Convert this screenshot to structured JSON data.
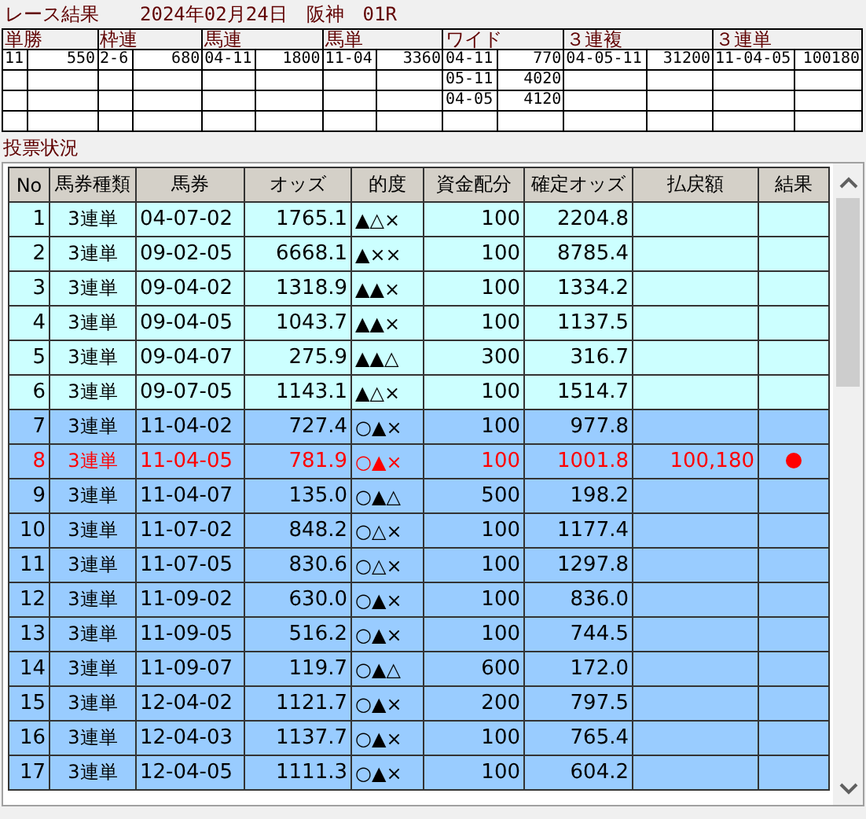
{
  "title": "レース結果",
  "date": "2024年02月24日",
  "venue": "阪神",
  "race": "01R",
  "results": [
    {
      "label": "単勝",
      "entries": [
        [
          "11",
          "550"
        ]
      ]
    },
    {
      "label": "枠連",
      "entries": [
        [
          "2-6",
          "680"
        ]
      ]
    },
    {
      "label": "馬連",
      "entries": [
        [
          "04-11",
          "1800"
        ]
      ]
    },
    {
      "label": "馬単",
      "entries": [
        [
          "11-04",
          "3360"
        ]
      ]
    },
    {
      "label": "ワイド",
      "entries": [
        [
          "04-11",
          "770"
        ],
        [
          "05-11",
          "4020"
        ],
        [
          "04-05",
          "4120"
        ]
      ]
    },
    {
      "label": "３連複",
      "entries": [
        [
          "04-05-11",
          "31200"
        ]
      ]
    },
    {
      "label": "３連単",
      "entries": [
        [
          "11-04-05",
          "100180"
        ]
      ]
    }
  ],
  "section": "投票状況",
  "columns": [
    "No",
    "馬券種類",
    "馬券",
    "オッズ",
    "的度",
    "資金配分",
    "確定オッズ",
    "払戻額",
    "結果"
  ],
  "rows": [
    {
      "no": "1",
      "type": "3連単",
      "ticket": "04-07-02",
      "odds": "1765.1",
      "marks": "▲△×",
      "stake": "100",
      "final": "2204.8",
      "hit": false,
      "color": "#ccffff"
    },
    {
      "no": "2",
      "type": "3連単",
      "ticket": "09-02-05",
      "odds": "6668.1",
      "marks": "▲××",
      "stake": "100",
      "final": "8785.4",
      "hit": false,
      "color": "#ccffff"
    },
    {
      "no": "3",
      "type": "3連単",
      "ticket": "09-04-02",
      "odds": "1318.9",
      "marks": "▲▲×",
      "stake": "100",
      "final": "1334.2",
      "hit": false,
      "color": "#ccffff"
    },
    {
      "no": "4",
      "type": "3連単",
      "ticket": "09-04-05",
      "odds": "1043.7",
      "marks": "▲▲×",
      "stake": "100",
      "final": "1137.5",
      "hit": false,
      "color": "#ccffff"
    },
    {
      "no": "5",
      "type": "3連単",
      "ticket": "09-04-07",
      "odds": "275.9",
      "marks": "▲▲△",
      "stake": "300",
      "final": "316.7",
      "hit": false,
      "color": "#ccffff"
    },
    {
      "no": "6",
      "type": "3連単",
      "ticket": "09-07-05",
      "odds": "1143.1",
      "marks": "▲△×",
      "stake": "100",
      "final": "1514.7",
      "hit": false,
      "color": "#ccffff"
    },
    {
      "no": "7",
      "type": "3連単",
      "ticket": "11-04-02",
      "odds": "727.4",
      "marks": "○▲×",
      "stake": "100",
      "final": "977.8",
      "hit": false,
      "color": "#99ccff"
    },
    {
      "no": "8",
      "type": "3連単",
      "ticket": "11-04-05",
      "odds": "781.9",
      "marks": "○▲×",
      "stake": "100",
      "final": "1001.8",
      "payout": "100,180",
      "hit": true,
      "color": "#99ccff"
    },
    {
      "no": "9",
      "type": "3連単",
      "ticket": "11-04-07",
      "odds": "135.0",
      "marks": "○▲△",
      "stake": "500",
      "final": "198.2",
      "hit": false,
      "color": "#99ccff"
    },
    {
      "no": "10",
      "type": "3連単",
      "ticket": "11-07-02",
      "odds": "848.2",
      "marks": "○△×",
      "stake": "100",
      "final": "1177.4",
      "hit": false,
      "color": "#99ccff"
    },
    {
      "no": "11",
      "type": "3連単",
      "ticket": "11-07-05",
      "odds": "830.6",
      "marks": "○△×",
      "stake": "100",
      "final": "1297.8",
      "hit": false,
      "color": "#99ccff"
    },
    {
      "no": "12",
      "type": "3連単",
      "ticket": "11-09-02",
      "odds": "630.0",
      "marks": "○▲×",
      "stake": "100",
      "final": "836.0",
      "hit": false,
      "color": "#99ccff"
    },
    {
      "no": "13",
      "type": "3連単",
      "ticket": "11-09-05",
      "odds": "516.2",
      "marks": "○▲×",
      "stake": "100",
      "final": "744.5",
      "hit": false,
      "color": "#99ccff"
    },
    {
      "no": "14",
      "type": "3連単",
      "ticket": "11-09-07",
      "odds": "119.7",
      "marks": "○▲△",
      "stake": "600",
      "final": "172.0",
      "hit": false,
      "color": "#99ccff"
    },
    {
      "no": "15",
      "type": "3連単",
      "ticket": "12-04-02",
      "odds": "1121.7",
      "marks": "○▲×",
      "stake": "200",
      "final": "797.5",
      "hit": false,
      "color": "#99ccff"
    },
    {
      "no": "16",
      "type": "3連単",
      "ticket": "12-04-03",
      "odds": "1137.7",
      "marks": "○▲×",
      "stake": "100",
      "final": "765.4",
      "hit": false,
      "color": "#99ccff"
    },
    {
      "no": "17",
      "type": "3連単",
      "ticket": "12-04-05",
      "odds": "1111.3",
      "marks": "○▲×",
      "stake": "100",
      "final": "604.2",
      "hit": false,
      "color": "#99ccff"
    }
  ]
}
